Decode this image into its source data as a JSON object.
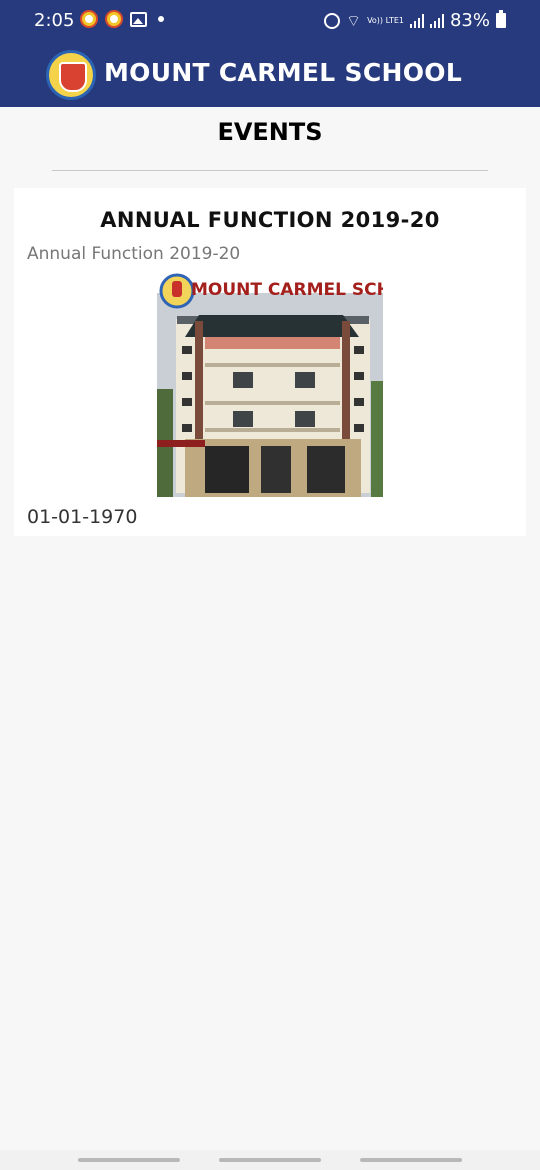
{
  "status_bar": {
    "time": "2:05",
    "battery": "83%",
    "network": "Vo)) LTE1",
    "icons": [
      "notification-icon",
      "notification-icon",
      "gallery-icon",
      "dot-icon",
      "alarm-icon",
      "wifi-icon",
      "signal-icon",
      "signal-icon",
      "battery-icon"
    ]
  },
  "app_bar": {
    "title": "MOUNT CARMEL SCHOOL",
    "logo": "school-crest-logo"
  },
  "page": {
    "title": "EVENTS"
  },
  "events": [
    {
      "title": "ANNUAL FUNCTION 2019-20",
      "description": "Annual Function 2019-20",
      "image_caption": "MOUNT CARMEL SCHOOL",
      "date": "01-01-1970"
    }
  ],
  "colors": {
    "primary": "#263a7d",
    "background": "#f7f7f7",
    "card": "#ffffff",
    "image_caption": "#a3201d"
  }
}
